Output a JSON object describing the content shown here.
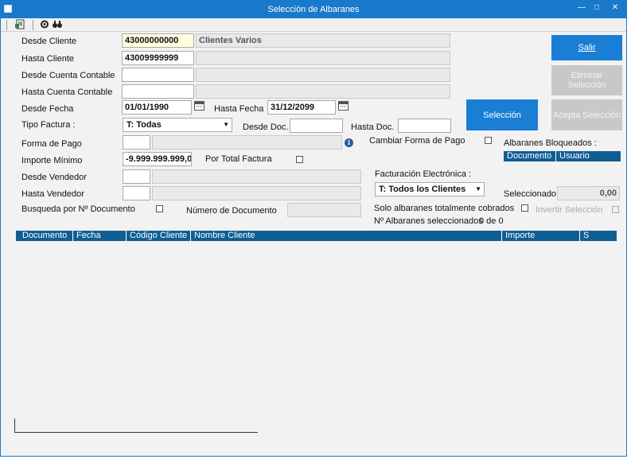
{
  "window": {
    "title": "Selección de Albaranes"
  },
  "labels": {
    "desde_cliente": "Desde Cliente",
    "hasta_cliente": "Hasta Cliente",
    "desde_cuenta": "Desde Cuenta Contable",
    "hasta_cuenta": "Hasta Cuenta Contable",
    "desde_fecha": "Desde Fecha",
    "hasta_fecha": "Hasta Fecha",
    "tipo_factura": "Tipo Factura :",
    "desde_doc": "Desde Doc.",
    "hasta_doc": "Hasta Doc.",
    "forma_pago": "Forma de Pago",
    "cambiar_forma_pago": "Cambiar Forma de Pago",
    "importe_minimo": "Importe Mínimo",
    "por_total_factura": "Por Total Factura",
    "desde_vendedor": "Desde Vendedor",
    "hasta_vendedor": "Hasta Vendedor",
    "busqueda_doc": "Busqueda por Nº Documento",
    "numero_documento": "Número de Documento",
    "facturacion_electronica": "Facturación Electrónica :",
    "solo_cobrados": "Solo albaranes totalmente cobrados",
    "invertir_seleccion": "Invertir Selección",
    "seleccionados_label": "Nº Albaranes seleccionados",
    "seleccionados_value": "0 de 0",
    "seleccionado": "Seleccionado",
    "albaranes_bloqueados": "Albaranes Bloqueados :"
  },
  "fields": {
    "desde_cliente": "43000000000",
    "desde_cliente_nombre": "Clientes Varios",
    "hasta_cliente": "43009999999",
    "desde_fecha": "01/01/1990",
    "hasta_fecha": "31/12/2099",
    "tipo_factura": "T: Todas",
    "importe_minimo": "-9.999.999.999,00",
    "facturacion_electronica": "T: Todos los Clientes",
    "seleccionado": "0,00"
  },
  "buttons": {
    "salir": "Salir",
    "eliminar_seleccion": "Eliminar Selección",
    "acepta_seleccion": "Acepta Selección",
    "seleccion": "Selección"
  },
  "bloqueados_columns": [
    "Documento",
    "Usuario"
  ],
  "grid_columns": [
    "Documento",
    "Fecha",
    "Código Cliente",
    "Nombre Cliente",
    "Importe",
    "S"
  ],
  "colors": {
    "accent": "#1979ca",
    "header": "#0f5e93",
    "button": "#1a7fd4",
    "disabled": "#c8c8c8"
  }
}
